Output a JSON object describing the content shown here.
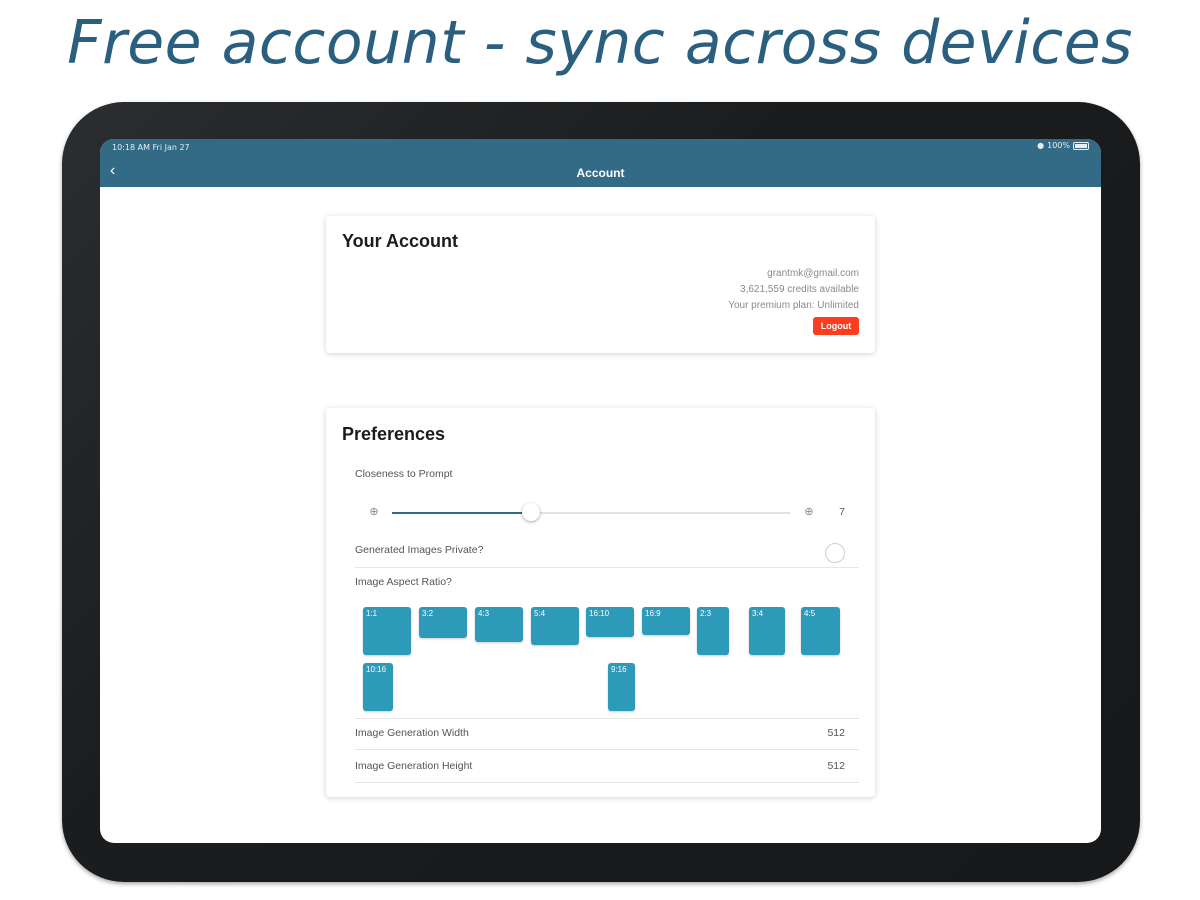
{
  "headline": "Free account - sync across devices",
  "status_bar": {
    "time": "10:18 AM  Fri Jan 27",
    "battery": "100%"
  },
  "navbar": {
    "title": "Account"
  },
  "account_card": {
    "title": "Your Account",
    "email": "grantmk@gmail.com",
    "credits": "3,621,559 credits available",
    "plan": "Your premium plan: Unlimited",
    "logout_label": "Logout"
  },
  "preferences_card": {
    "title": "Preferences",
    "closeness_label": "Closeness to Prompt",
    "closeness_value": "7",
    "closeness_fraction": 0.35,
    "private_label": "Generated Images Private?",
    "aspect_label": "Image Aspect Ratio?",
    "aspect_ratios": [
      "1:1",
      "3:2",
      "4:3",
      "5:4",
      "16:10",
      "16:9",
      "2:3",
      "3:4",
      "4:5",
      "10:16",
      "9:16"
    ],
    "width_label": "Image Generation Width",
    "width_value": "512",
    "height_label": "Image Generation Height",
    "height_value": "512"
  },
  "colors": {
    "navbar": "#336b87",
    "accent": "#2d9ab9",
    "logout": "#ff3b1f",
    "headline": "#2a5f7f"
  }
}
